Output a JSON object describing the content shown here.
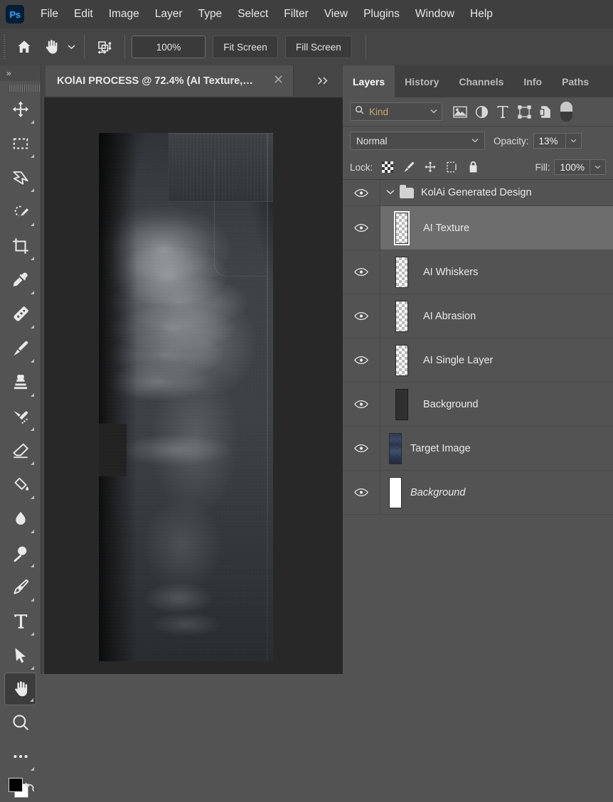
{
  "app": {
    "logo_text": "Ps",
    "menus": [
      "File",
      "Edit",
      "Image",
      "Layer",
      "Type",
      "Select",
      "Filter",
      "View",
      "Plugins",
      "Window",
      "Help"
    ]
  },
  "options_bar": {
    "home_icon": "home-icon",
    "tool_icon": "hand-tool-icon",
    "tool_chevron": "chevron-down-icon",
    "arrange_icon": "rotate-view-icon",
    "buttons": [
      "100%",
      "Fit Screen",
      "Fill Screen"
    ]
  },
  "toolbar": {
    "collapse_label": "»",
    "tools": [
      {
        "name": "move-tool",
        "glyph": "move"
      },
      {
        "name": "rectangular-marquee-tool",
        "glyph": "marquee"
      },
      {
        "name": "lasso-tool",
        "glyph": "lasso"
      },
      {
        "name": "quick-selection-tool",
        "glyph": "quickselect"
      },
      {
        "name": "crop-tool",
        "glyph": "crop"
      },
      {
        "name": "eyedropper-tool",
        "glyph": "eyedropper"
      },
      {
        "name": "spot-healing-brush-tool",
        "glyph": "healing"
      },
      {
        "name": "brush-tool",
        "glyph": "brush"
      },
      {
        "name": "clone-stamp-tool",
        "glyph": "stamp"
      },
      {
        "name": "history-brush-tool",
        "glyph": "historybrush"
      },
      {
        "name": "eraser-tool",
        "glyph": "eraser"
      },
      {
        "name": "paint-bucket-tool",
        "glyph": "bucket"
      },
      {
        "name": "blur-tool",
        "glyph": "drop"
      },
      {
        "name": "dodge-tool",
        "glyph": "dodge"
      },
      {
        "name": "pen-tool",
        "glyph": "pen"
      },
      {
        "name": "type-tool",
        "glyph": "T"
      },
      {
        "name": "path-selection-tool",
        "glyph": "arrow"
      },
      {
        "name": "hand-tool",
        "glyph": "hand",
        "active": true
      },
      {
        "name": "zoom-tool",
        "glyph": "zoom"
      },
      {
        "name": "edit-toolbar-more",
        "glyph": "dots"
      }
    ],
    "foreground_color": "#000000",
    "background_color": "#ffffff",
    "swap_icon": "swap-colors-icon"
  },
  "document": {
    "tab_title": "KOlAI PROCESS @ 72.4% (AI Texture,…",
    "close_icon": "close-icon",
    "more_tabs_icon": "double-chevron-right-icon",
    "canvas_background": "#282828",
    "zoom_level": "72.4%"
  },
  "panel": {
    "tabs": [
      {
        "label": "Layers",
        "active": true
      },
      {
        "label": "History",
        "active": false
      },
      {
        "label": "Channels",
        "active": false
      },
      {
        "label": "Info",
        "active": false
      },
      {
        "label": "Paths",
        "active": false
      }
    ],
    "filter": {
      "search_icon": "search-icon",
      "kind_label": "Kind",
      "chevron": "chevron-down-icon",
      "icons": [
        "image-filter-icon",
        "adjustment-filter-icon",
        "type-filter-icon",
        "shape-filter-icon",
        "smart-object-filter-icon",
        "filter-toggle-switch"
      ]
    },
    "blend": {
      "mode": "Normal",
      "mode_chevron": "chevron-down-icon",
      "opacity_label": "Opacity:",
      "opacity_value": "13%",
      "opacity_chevron": "chevron-down-icon"
    },
    "lock": {
      "label": "Lock:",
      "icons": [
        "lock-transparent-pixels-icon",
        "lock-image-pixels-icon",
        "lock-position-icon",
        "lock-artboard-nesting-icon",
        "lock-all-icon"
      ],
      "fill_label": "Fill:",
      "fill_value": "100%",
      "fill_chevron": "chevron-down-icon"
    },
    "layers": [
      {
        "name": "KolAi Generated Design",
        "type": "group",
        "expanded": true,
        "visible": true,
        "selected": false,
        "thumb": "folder",
        "italic": false
      },
      {
        "name": "AI Texture",
        "type": "layer",
        "visible": true,
        "selected": true,
        "thumb": "transparent",
        "italic": false
      },
      {
        "name": "AI Whiskers",
        "type": "layer",
        "visible": true,
        "selected": false,
        "thumb": "transparent",
        "italic": false
      },
      {
        "name": "AI Abrasion",
        "type": "layer",
        "visible": true,
        "selected": false,
        "thumb": "transparent",
        "italic": false
      },
      {
        "name": "AI Single Layer",
        "type": "layer",
        "visible": true,
        "selected": false,
        "thumb": "transparent",
        "italic": false
      },
      {
        "name": "Background",
        "type": "layer",
        "visible": true,
        "selected": false,
        "thumb": "dark",
        "italic": false
      },
      {
        "name": "Target Image",
        "type": "layer",
        "visible": true,
        "selected": false,
        "thumb": "jeans",
        "italic": false
      },
      {
        "name": "Background",
        "type": "layer",
        "visible": true,
        "selected": false,
        "thumb": "white",
        "italic": true
      }
    ],
    "eye_icon": "eye-visibility-icon"
  }
}
